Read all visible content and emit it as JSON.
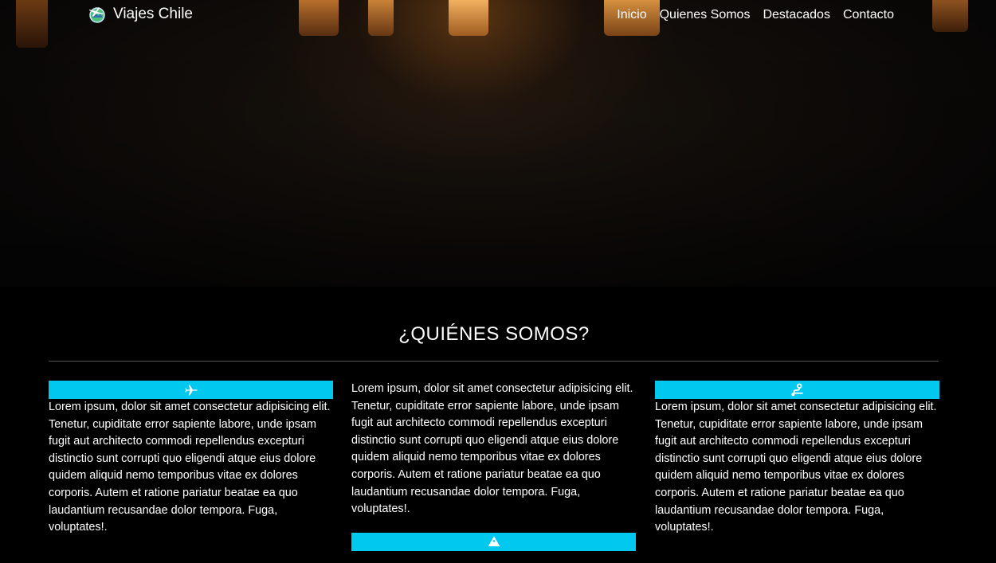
{
  "navbar": {
    "brand_name": "Viajes Chile",
    "links": [
      {
        "label": "Inicio"
      },
      {
        "label": "Quienes Somos"
      },
      {
        "label": "Destacados"
      },
      {
        "label": "Contacto"
      }
    ]
  },
  "about": {
    "title": "¿QUIÉNES SOMOS?",
    "columns": [
      {
        "icon": "airplane-icon",
        "text": "Lorem ipsum, dolor sit amet consectetur adipisicing elit. Tenetur, cupiditate error sapiente labore, unde ipsam fugit aut architecto commodi repellendus excepturi distinctio sunt corrupti quo eligendi atque eius dolore quidem aliquid nemo temporibus vitae ex dolores corporis. Autem et ratione pariatur beatae ea quo laudantium recusandae dolor tempora. Fuga, voluptates!."
      },
      {
        "icon": "mountain-icon",
        "text": "Lorem ipsum, dolor sit amet consectetur adipisicing elit. Tenetur, cupiditate error sapiente labore, unde ipsam fugit aut architecto commodi repellendus excepturi distinctio sunt corrupti quo eligendi atque eius dolore quidem aliquid nemo temporibus vitae ex dolores corporis. Autem et ratione pariatur beatae ea quo laudantium recusandae dolor tempora. Fuga, voluptates!."
      },
      {
        "icon": "route-icon",
        "text": "Lorem ipsum, dolor sit amet consectetur adipisicing elit. Tenetur, cupiditate error sapiente labore, unde ipsam fugit aut architecto commodi repellendus excepturi distinctio sunt corrupti quo eligendi atque eius dolore quidem aliquid nemo temporibus vitae ex dolores corporis. Autem et ratione pariatur beatae ea quo laudantium recusandae dolor tempora. Fuga, voluptates!."
      }
    ]
  },
  "colors": {
    "accent": "#00c8ef",
    "background": "#000000",
    "text": "#ffffff"
  }
}
